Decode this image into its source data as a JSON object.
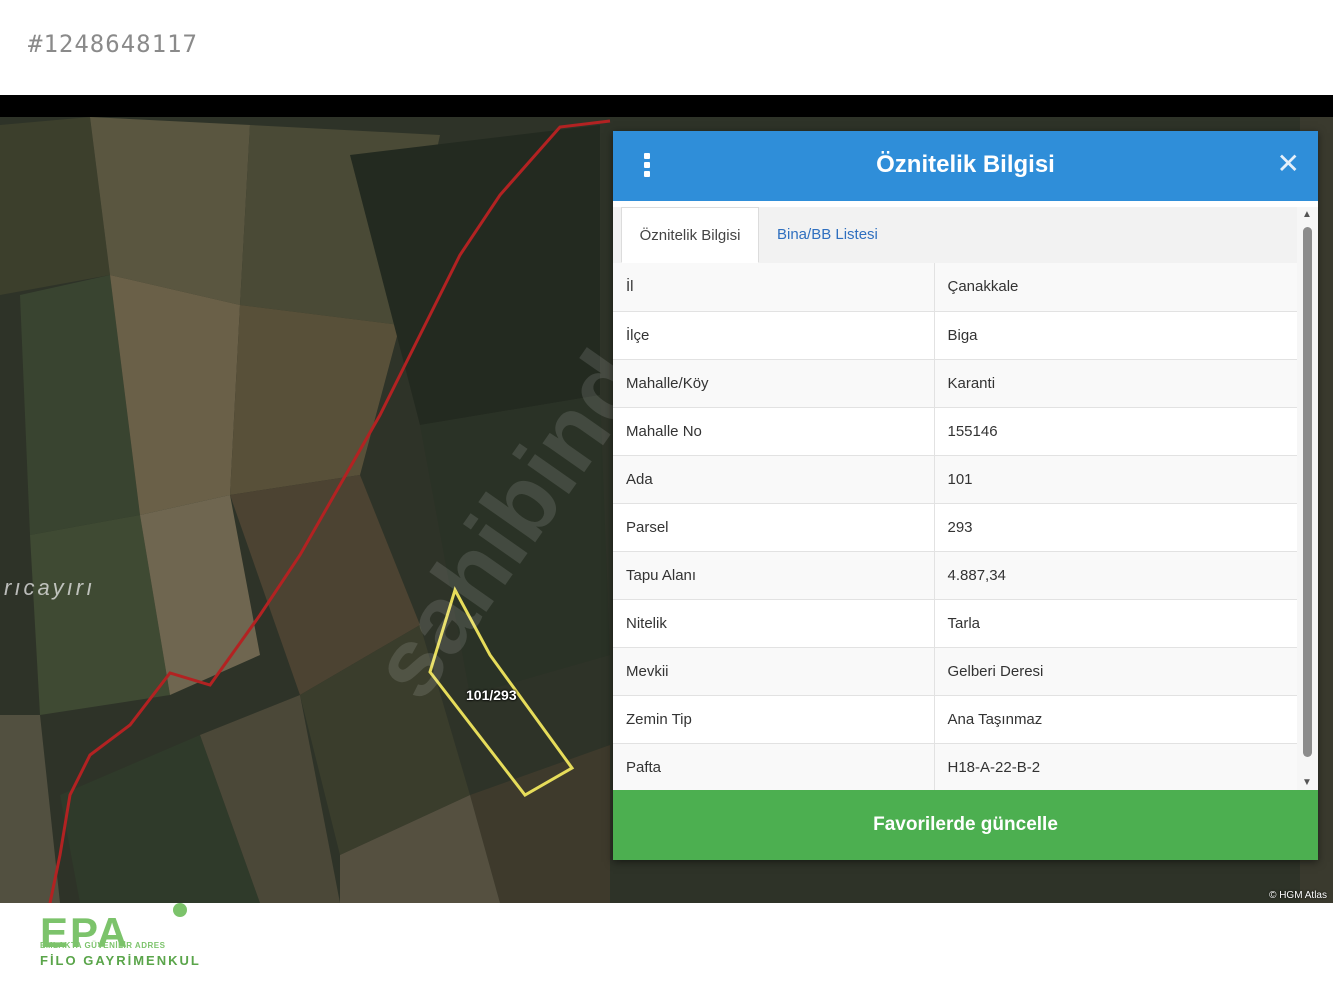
{
  "listing_id": "#1248648117",
  "map": {
    "place_label": "rıcayırı",
    "parcel_label": "101/293",
    "watermark": "sahibinden",
    "attribution": "© HGM Atlas"
  },
  "panel": {
    "title": "Öznitelik Bilgisi",
    "menu_icon": "vertical-dots-icon",
    "close_icon": "close-icon",
    "tabs": [
      {
        "label": "Öznitelik Bilgisi",
        "active": true
      },
      {
        "label": "Bina/BB Listesi",
        "active": false
      }
    ],
    "rows": [
      {
        "key": "İl",
        "value": "Çanakkale"
      },
      {
        "key": "İlçe",
        "value": "Biga"
      },
      {
        "key": "Mahalle/Köy",
        "value": "Karanti"
      },
      {
        "key": "Mahalle No",
        "value": "155146"
      },
      {
        "key": "Ada",
        "value": "101"
      },
      {
        "key": "Parsel",
        "value": "293"
      },
      {
        "key": "Tapu Alanı",
        "value": "4.887,34"
      },
      {
        "key": "Nitelik",
        "value": "Tarla"
      },
      {
        "key": "Mevkii",
        "value": "Gelberi Deresi"
      },
      {
        "key": "Zemin Tip",
        "value": "Ana Taşınmaz"
      },
      {
        "key": "Pafta",
        "value": "H18-A-22-B-2"
      }
    ],
    "action_button": "Favorilerde güncelle",
    "colors": {
      "header": "#2f8ed9",
      "button": "#4caf50"
    }
  },
  "logo": {
    "mark": "EPA",
    "tagline": "EMLAKTA GÜVENİLİR ADRES",
    "subtitle": "FİLO GAYRİMENKUL"
  }
}
